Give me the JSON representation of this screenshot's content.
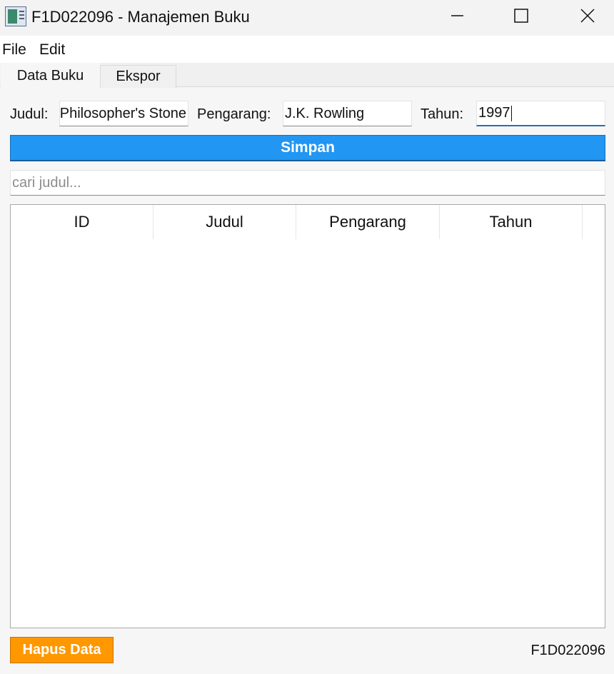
{
  "window": {
    "title": "F1D022096 - Manajemen Buku"
  },
  "menu": {
    "items": [
      "File",
      "Edit"
    ]
  },
  "tabs": [
    "Data Buku",
    "Ekspor"
  ],
  "form": {
    "judul_label": "Judul:",
    "judul_value": "Philosopher's Stone",
    "pengarang_label": "Pengarang:",
    "pengarang_value": "J.K. Rowling",
    "tahun_label": "Tahun:",
    "tahun_value": "1997"
  },
  "save_button": "Simpan",
  "search": {
    "placeholder": "cari judul..."
  },
  "table": {
    "columns": [
      "ID",
      "Judul",
      "Pengarang",
      "Tahun"
    ],
    "rows": []
  },
  "delete_button": "Hapus Data",
  "status": {
    "student_id": "F1D022096"
  },
  "colors": {
    "save_button": "#2196f3",
    "delete_button": "#ff9800"
  },
  "icons": {
    "app": "app-window-icon",
    "minimize": "minimize-icon",
    "maximize": "maximize-icon",
    "close": "close-icon"
  }
}
